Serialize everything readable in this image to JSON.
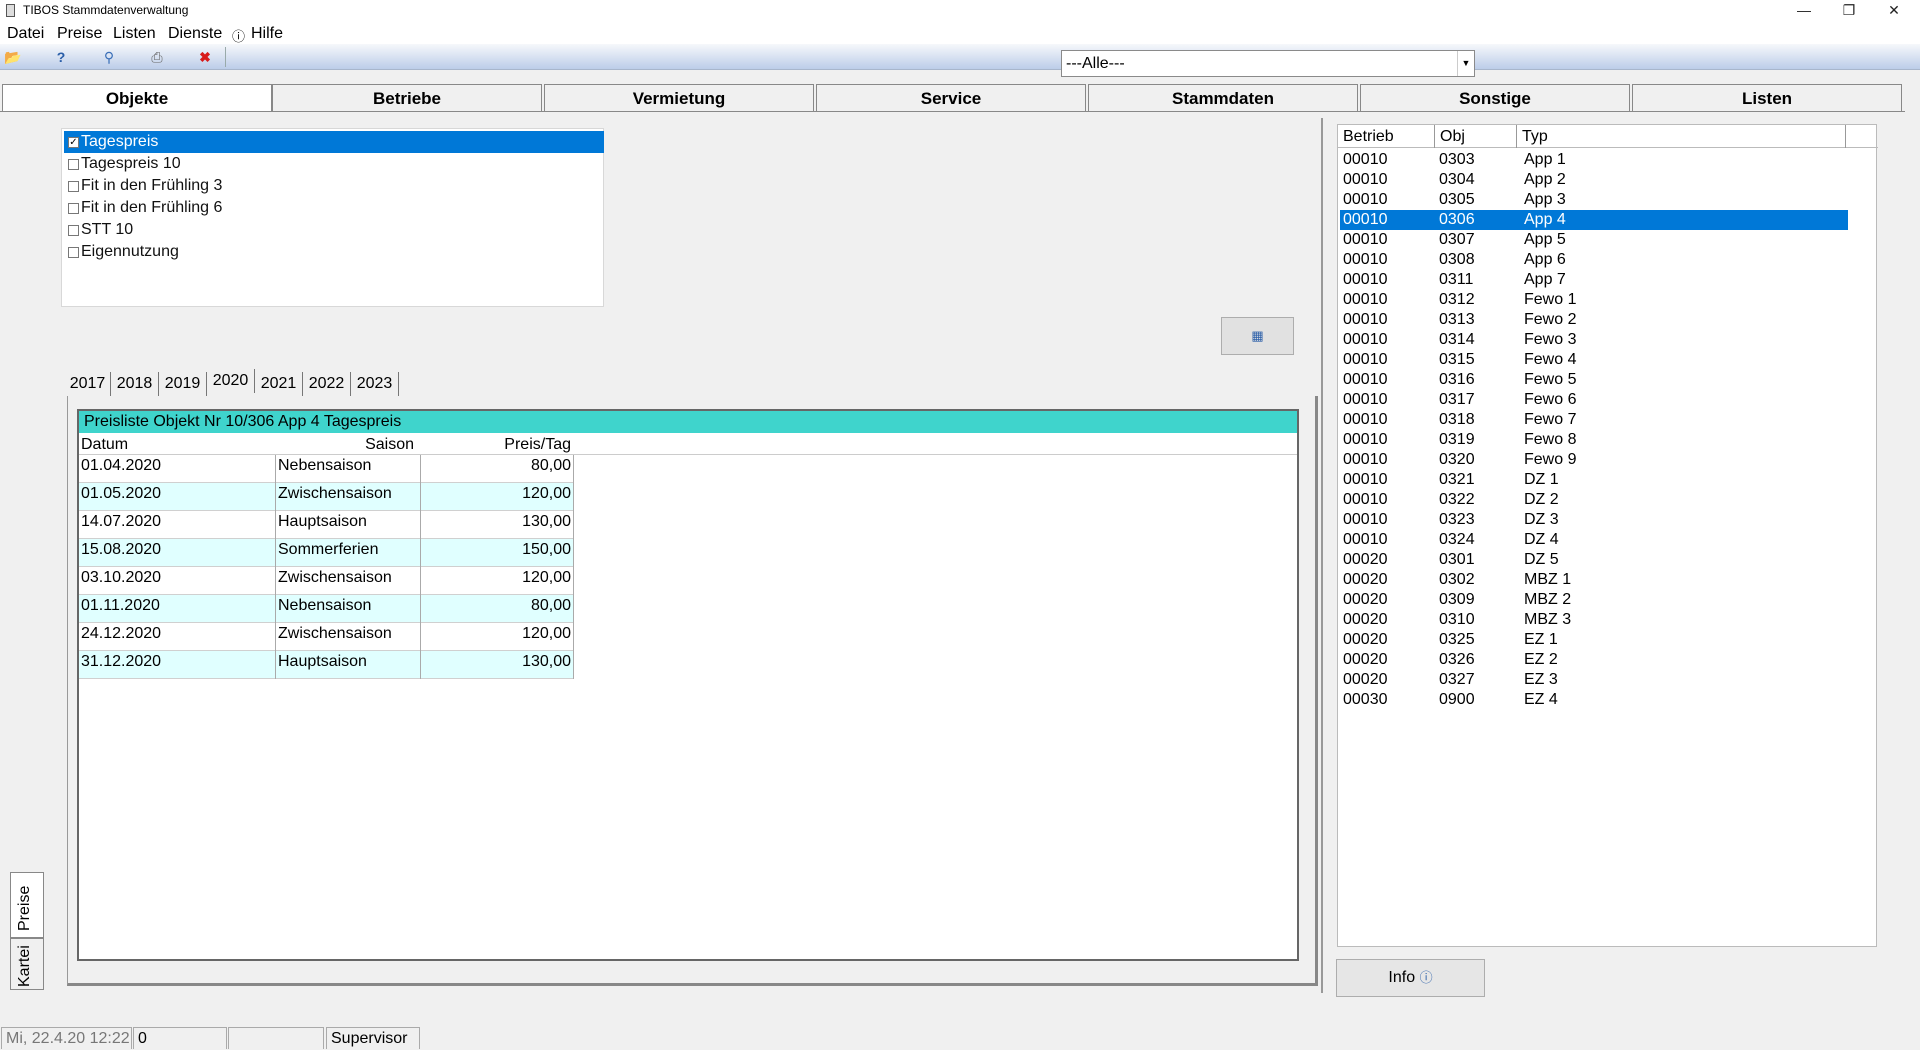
{
  "window": {
    "title": "TIBOS Stammdatenverwaltung",
    "minimize": "—",
    "restore": "❐",
    "close": "✕"
  },
  "menu": [
    "Datei",
    "Preise",
    "Listen",
    "Dienste",
    "Hilfe"
  ],
  "toolbar": {
    "icons": [
      "open-folder-icon",
      "help-icon",
      "search-icon",
      "print-icon",
      "delete-icon"
    ],
    "filter_value": "---Alle---"
  },
  "tabs": [
    "Objekte",
    "Betriebe",
    "Vermietung",
    "Service",
    "Stammdaten",
    "Sonstige",
    "Listen"
  ],
  "active_tab": "Objekte",
  "price_types": [
    {
      "label": "Tagespreis",
      "checked": true
    },
    {
      "label": "Tagespreis 10",
      "checked": false
    },
    {
      "label": "Fit in den Frühling 3",
      "checked": false
    },
    {
      "label": "Fit in den Frühling 6",
      "checked": false
    },
    {
      "label": "STT 10",
      "checked": false
    },
    {
      "label": "Eigennutzung",
      "checked": false
    }
  ],
  "years": [
    "2017",
    "2018",
    "2019",
    "2020",
    "2021",
    "2022",
    "2023"
  ],
  "active_year": "2020",
  "pricelist": {
    "title": "Preisliste Objekt Nr 10/306 App 4 Tagespreis",
    "columns": [
      "Datum",
      "Saison",
      "Preis/Tag"
    ],
    "rows": [
      [
        "01.04.2020",
        "Nebensaison",
        "80,00"
      ],
      [
        "01.05.2020",
        "Zwischensaison",
        "120,00"
      ],
      [
        "14.07.2020",
        "Hauptsaison",
        "130,00"
      ],
      [
        "15.08.2020",
        "Sommerferien",
        "150,00"
      ],
      [
        "03.10.2020",
        "Zwischensaison",
        "120,00"
      ],
      [
        "01.11.2020",
        "Nebensaison",
        "80,00"
      ],
      [
        "24.12.2020",
        "Zwischensaison",
        "120,00"
      ],
      [
        "31.12.2020",
        "Hauptsaison",
        "130,00"
      ]
    ]
  },
  "side_tabs": [
    "Preise",
    "Kartei"
  ],
  "object_list": {
    "columns": [
      "Betrieb",
      "Obj",
      "Typ"
    ],
    "selected_index": 3,
    "rows": [
      [
        "00010",
        "0303",
        "App 1"
      ],
      [
        "00010",
        "0304",
        "App 2"
      ],
      [
        "00010",
        "0305",
        "App 3"
      ],
      [
        "00010",
        "0306",
        "App 4"
      ],
      [
        "00010",
        "0307",
        "App 5"
      ],
      [
        "00010",
        "0308",
        "App 6"
      ],
      [
        "00010",
        "0311",
        "App 7"
      ],
      [
        "00010",
        "0312",
        "Fewo 1"
      ],
      [
        "00010",
        "0313",
        "Fewo 2"
      ],
      [
        "00010",
        "0314",
        "Fewo 3"
      ],
      [
        "00010",
        "0315",
        "Fewo 4"
      ],
      [
        "00010",
        "0316",
        "Fewo 5"
      ],
      [
        "00010",
        "0317",
        "Fewo 6"
      ],
      [
        "00010",
        "0318",
        "Fewo 7"
      ],
      [
        "00010",
        "0319",
        "Fewo 8"
      ],
      [
        "00010",
        "0320",
        "Fewo 9"
      ],
      [
        "00010",
        "0321",
        "DZ 1"
      ],
      [
        "00010",
        "0322",
        "DZ 2"
      ],
      [
        "00010",
        "0323",
        "DZ 3"
      ],
      [
        "00010",
        "0324",
        "DZ 4"
      ],
      [
        "00020",
        "0301",
        "DZ 5"
      ],
      [
        "00020",
        "0302",
        "MBZ 1"
      ],
      [
        "00020",
        "0309",
        "MBZ 2"
      ],
      [
        "00020",
        "0310",
        "MBZ 3"
      ],
      [
        "00020",
        "0325",
        "EZ 1"
      ],
      [
        "00020",
        "0326",
        "EZ 2"
      ],
      [
        "00020",
        "0327",
        "EZ 3"
      ],
      [
        "00030",
        "0900",
        "EZ 4"
      ]
    ]
  },
  "info_button": "Info",
  "status": {
    "datetime": "Mi, 22.4.20 12:22",
    "count": "0",
    "empty": "",
    "user": "Supervisor"
  },
  "colors": {
    "selection": "#0078d7",
    "header_teal": "#3fd4cc",
    "alt_row": "#e0ffff"
  }
}
